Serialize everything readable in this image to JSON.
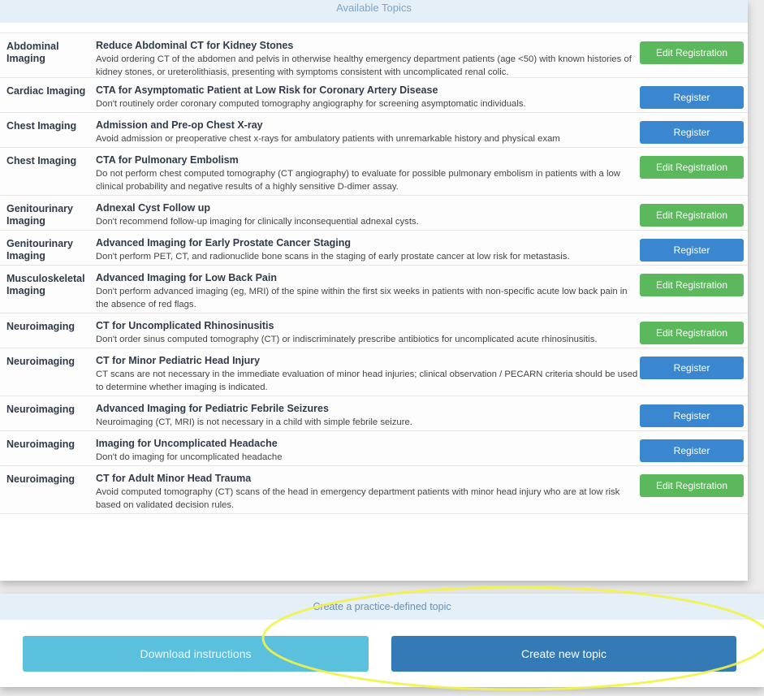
{
  "available_topics_header": "Available Topics",
  "topics": [
    {
      "category": "Abdominal Imaging",
      "title": "Reduce Abdominal CT for Kidney Stones",
      "description": "Avoid ordering CT of the abdomen and pelvis in otherwise healthy emergency department patients (age <50) with known histories of kidney stones, or ureterolithiasis, presenting with symptoms consistent with uncomplicated renal colic.",
      "action": "Edit Registration",
      "registered": true
    },
    {
      "category": "Cardiac Imaging",
      "title": "CTA for Asymptomatic Patient at Low Risk for Coronary Artery Disease",
      "description": "Don't routinely order coronary computed tomography angiography for screening asymptomatic individuals.",
      "action": "Register",
      "registered": false
    },
    {
      "category": "Chest Imaging",
      "title": "Admission and Pre-op Chest X-ray",
      "description": "Avoid admission or preoperative chest x-rays for ambulatory patients with unremarkable history and physical exam",
      "action": "Register",
      "registered": false
    },
    {
      "category": "Chest Imaging",
      "title": "CTA for Pulmonary Embolism",
      "description": "Do not perform chest computed tomography (CT angiography) to evaluate for possible pulmonary embolism in patients with a low clinical probability and negative results of a highly sensitive D-dimer assay.",
      "action": "Edit Registration",
      "registered": true
    },
    {
      "category": "Genitourinary Imaging",
      "title": "Adnexal Cyst Follow up",
      "description": "Don't recommend follow-up imaging for clinically inconsequential adnexal cysts.",
      "action": "Edit Registration",
      "registered": true
    },
    {
      "category": "Genitourinary Imaging",
      "title": "Advanced Imaging for Early Prostate Cancer Staging",
      "description": "Don't perform PET, CT, and radionuclide bone scans in the staging of early prostate cancer at low risk for metastasis.",
      "action": "Register",
      "registered": false
    },
    {
      "category": "Musculoskeletal Imaging",
      "title": "Advanced Imaging for Low Back Pain",
      "description": "Don't perform advanced imaging (eg, MRI) of the spine within the first six weeks in patients with non-specific acute low back pain in the absence of red flags.",
      "action": "Edit Registration",
      "registered": true
    },
    {
      "category": "Neuroimaging",
      "title": "CT for Uncomplicated Rhinosinusitis",
      "description": "Don't order sinus computed tomography (CT) or indiscriminately prescribe antibiotics for uncomplicated acute rhinosinusitis.",
      "action": "Edit Registration",
      "registered": true
    },
    {
      "category": "Neuroimaging",
      "title": "CT for Minor Pediatric Head Injury",
      "description": "CT scans are not necessary in the immediate evaluation of minor head injuries; clinical observation / PECARN criteria should be used to determine whether imaging is indicated.",
      "action": "Register",
      "registered": false
    },
    {
      "category": "Neuroimaging",
      "title": "Advanced Imaging for Pediatric Febrile Seizures",
      "description": "Neuroimaging (CT, MRI) is not necessary in a child with simple febrile seizure.",
      "action": "Register",
      "registered": false
    },
    {
      "category": "Neuroimaging",
      "title": "Imaging for Uncomplicated Headache",
      "description": "Don't do imaging for uncomplicated headache",
      "action": "Register",
      "registered": false
    },
    {
      "category": "Neuroimaging",
      "title": "CT for Adult Minor Head Trauma",
      "description": "Avoid computed tomography (CT) scans of the head in emergency department patients with minor head injury who are at low risk based on validated decision rules.",
      "action": "Edit Registration",
      "registered": true
    }
  ],
  "practice_header": "Create a practice-defined topic",
  "download_label": "Download instructions",
  "create_label": "Create new topic",
  "colors": {
    "green": "#5cb85c",
    "blue": "#3a87cf",
    "highlight": "#f2f24a"
  }
}
